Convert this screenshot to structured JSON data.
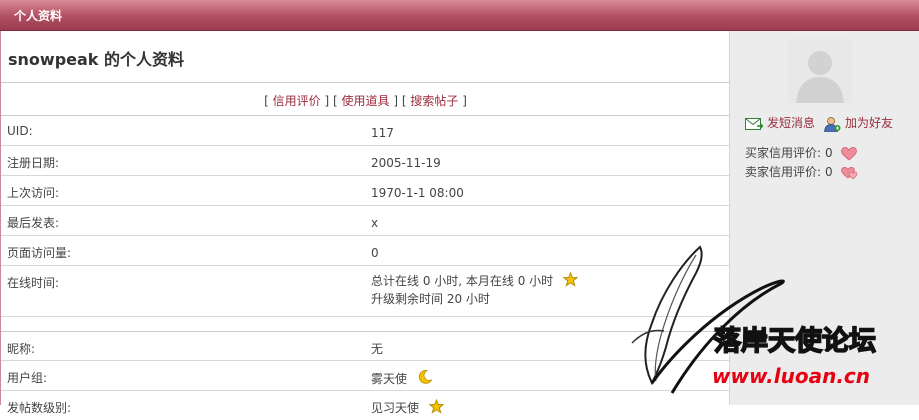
{
  "header": {
    "title": "个人资料"
  },
  "main": {
    "title": "snowpeak 的个人资料",
    "links": {
      "open1": "[",
      "credit": "信用评价",
      "close1": "]",
      "open2": "[",
      "props": "使用道具",
      "close2": "]",
      "open3": "[",
      "search": "搜索帖子",
      "close3": "]"
    },
    "rows": [
      {
        "label": "UID:",
        "value": "117"
      },
      {
        "label": "注册日期:",
        "value": "2005-11-19"
      },
      {
        "label": "上次访问:",
        "value": "1970-1-1 08:00"
      },
      {
        "label": "最后发表:",
        "value": "x"
      },
      {
        "label": "页面访问量:",
        "value": "0"
      },
      {
        "label": "在线时间:",
        "value_line1": "总计在线  0 小时, 本月在线  0 小时",
        "value_line2": "升级剩余时间  20 小时"
      },
      {
        "label": "昵称:",
        "value": "无"
      },
      {
        "label": "用户组:",
        "value": "雾天使"
      },
      {
        "label": "发帖数级别:",
        "value": "见习天使"
      }
    ]
  },
  "sidebar": {
    "send_message": "发短消息",
    "add_friend": "加为好友",
    "buyer_credit_label": "买家信用评价:",
    "buyer_credit_value": "0",
    "seller_credit_label": "卖家信用评价:",
    "seller_credit_value": "0"
  },
  "watermark": {
    "name": "落岸天使论坛",
    "url": "www.luoan.cn"
  },
  "icons": {
    "online_time": "star-icon",
    "user_group": "moon-icon",
    "post_level": "star-icon",
    "buyer_credit": "heart-icon",
    "seller_credit": "heart-icon"
  },
  "colors": {
    "header": "#b04f62",
    "link": "#9b2c3c",
    "sidebar_bg": "#ececec",
    "watermark_url": "#e60012"
  }
}
